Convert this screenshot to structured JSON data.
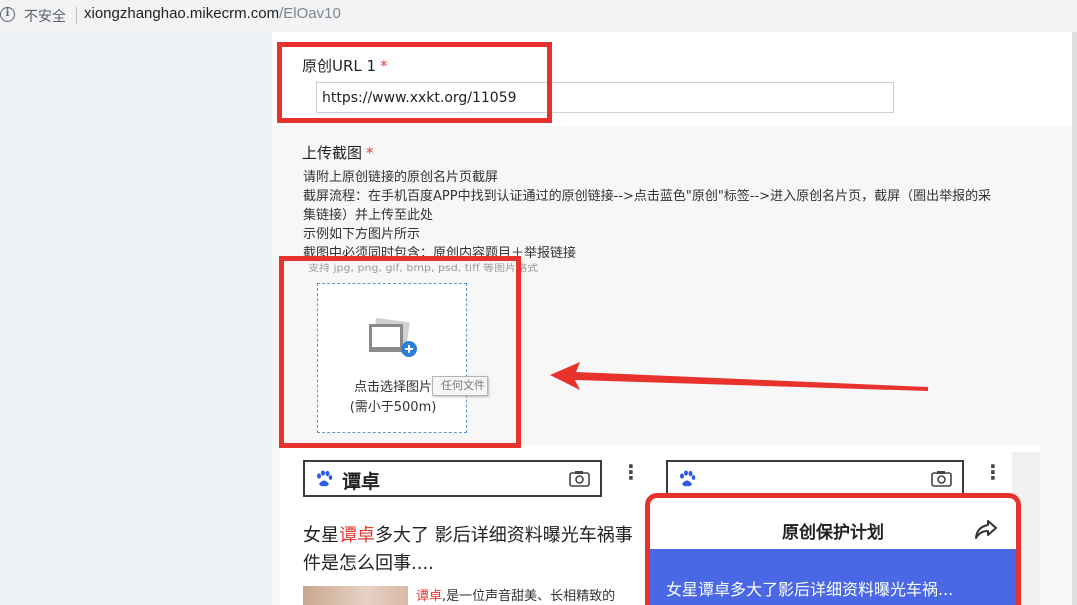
{
  "browser": {
    "security_label": "不安全",
    "url_host": "xiongzhanghao.mikecrm.com",
    "url_path": "/ElOav10"
  },
  "form": {
    "url_field": {
      "label": "原创URL 1",
      "required_mark": "*",
      "value": "https://www.xxkt.org/11059"
    },
    "upload_field": {
      "label": "上传截图",
      "required_mark": "*",
      "description": [
        "请附上原创链接的原创名片页截屏",
        "截屏流程：在手机百度APP中找到认证通过的原创链接-->点击蓝色\"原创\"标签-->进入原创名片页，截屏（圈出举报的采",
        "集链接）并上传至此处",
        "示例如下方图片所示",
        "截图中必须同时包含：原创内容题目＋举报链接"
      ],
      "formats_hint": "支持 jpg, png, gif, bmp, psd, tiff 等图片格式",
      "pick_label": "点击选择图片",
      "size_limit": "(需小于500m)",
      "tooltip": "任何文件"
    }
  },
  "sample": {
    "search_query": "谭卓",
    "article_title_prefix": "女星",
    "article_title_highlight": "谭卓",
    "article_title_rest": "多大了 影后详细资料曝光车祸事件是怎么回事....",
    "snippet_highlight": "谭卓",
    "snippet_rest": ",是一位声音甜美、长相精致的",
    "popup_title": "原创保护计划",
    "popup_text": "女星谭卓多大了影后详细资料曝光车祸..."
  },
  "colors": {
    "annotation_red": "#e8322d",
    "required_red": "#e53935",
    "upload_border": "#5b9bd5",
    "sample_blue": "#4a68e6"
  }
}
